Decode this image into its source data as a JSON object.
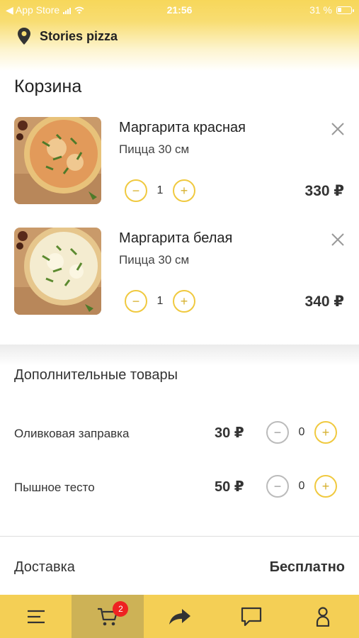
{
  "status_bar": {
    "back_label": "◀ App Store",
    "time": "21:56",
    "battery": "31 %"
  },
  "header": {
    "title": "Stories pizza"
  },
  "cart": {
    "title": "Корзина",
    "items": [
      {
        "name": "Маргарита красная",
        "desc": "Пицца 30 см",
        "qty": "1",
        "price": "330 ₽"
      },
      {
        "name": "Маргарита белая",
        "desc": "Пицца 30 см",
        "qty": "1",
        "price": "340 ₽"
      }
    ]
  },
  "extras": {
    "title": "Дополнительные товары",
    "items": [
      {
        "label": "Оливковая заправка",
        "price": "30 ₽",
        "qty": "0"
      },
      {
        "label": "Пышное тесто",
        "price": "50 ₽",
        "qty": "0"
      }
    ]
  },
  "delivery": {
    "label": "Доставка",
    "value": "Бесплатно"
  },
  "tabbar": {
    "cart_badge": "2",
    "tabs": [
      "menu-icon",
      "cart-icon",
      "share-icon",
      "chat-icon",
      "profile-icon"
    ],
    "active": 1
  },
  "colors": {
    "accent": "#f4cf55",
    "accent_dark": "#cdb256",
    "badge": "#ee2222",
    "control_border": "#f0c93f"
  }
}
